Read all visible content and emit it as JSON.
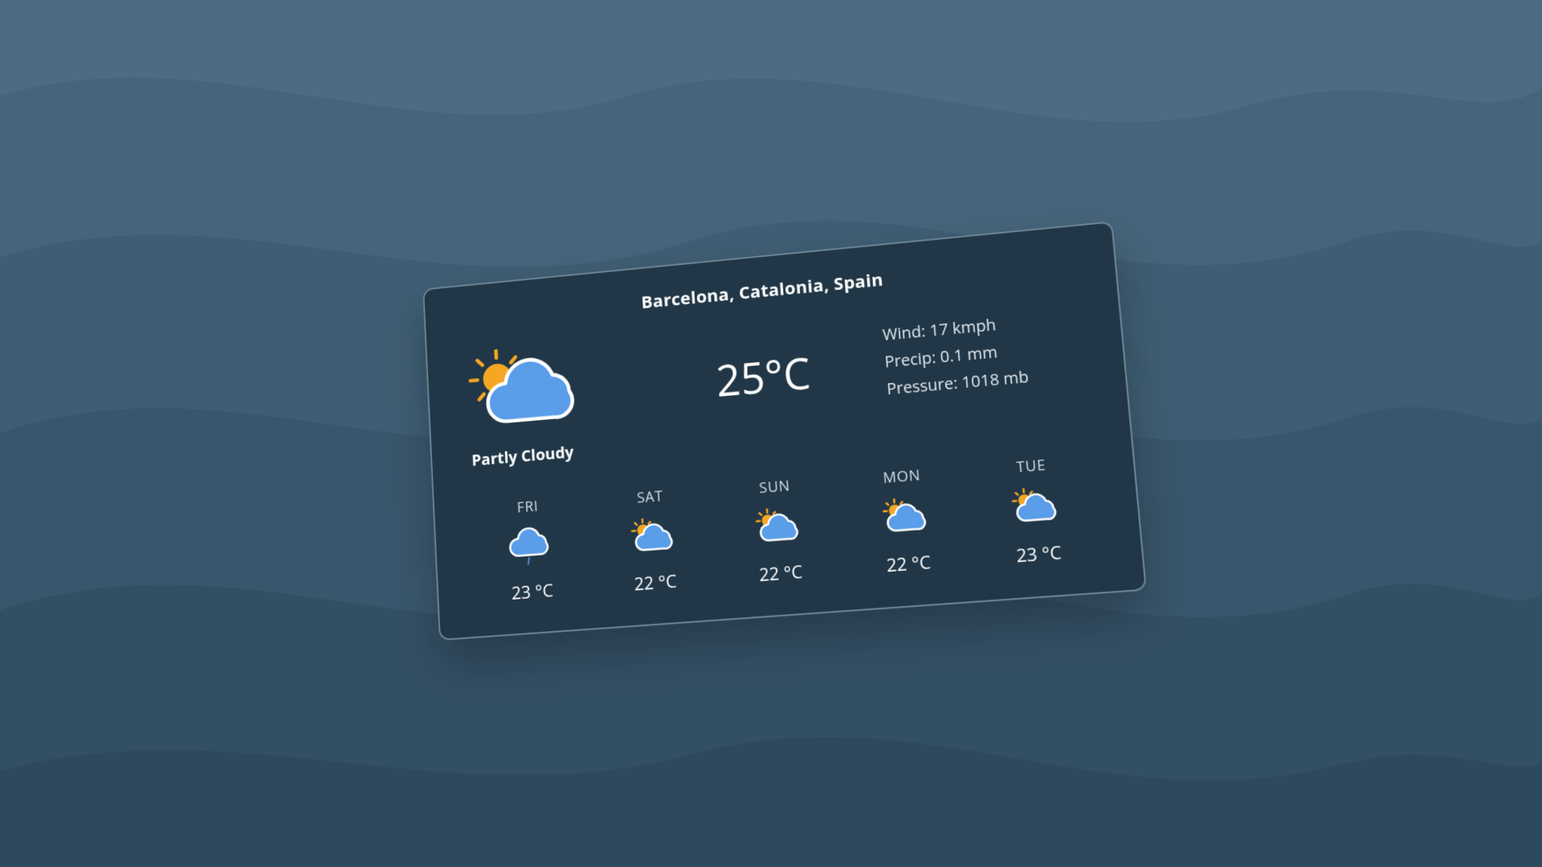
{
  "location": "Barcelona, Catalonia, Spain",
  "current": {
    "icon": "partly-cloudy",
    "condition": "Partly Cloudy",
    "temperature": "25°C",
    "wind": "Wind: 17 kmph",
    "precip": "Precip: 0.1 mm",
    "pressure": "Pressure: 1018 mb"
  },
  "forecast": [
    {
      "day": "FRI",
      "icon": "cloud-rain",
      "temp": "23 °C"
    },
    {
      "day": "SAT",
      "icon": "partly-cloudy",
      "temp": "22 °C"
    },
    {
      "day": "SUN",
      "icon": "partly-cloudy",
      "temp": "22 °C"
    },
    {
      "day": "MON",
      "icon": "partly-cloudy",
      "temp": "22 °C"
    },
    {
      "day": "TUE",
      "icon": "partly-cloudy",
      "temp": "23 °C"
    }
  ]
}
